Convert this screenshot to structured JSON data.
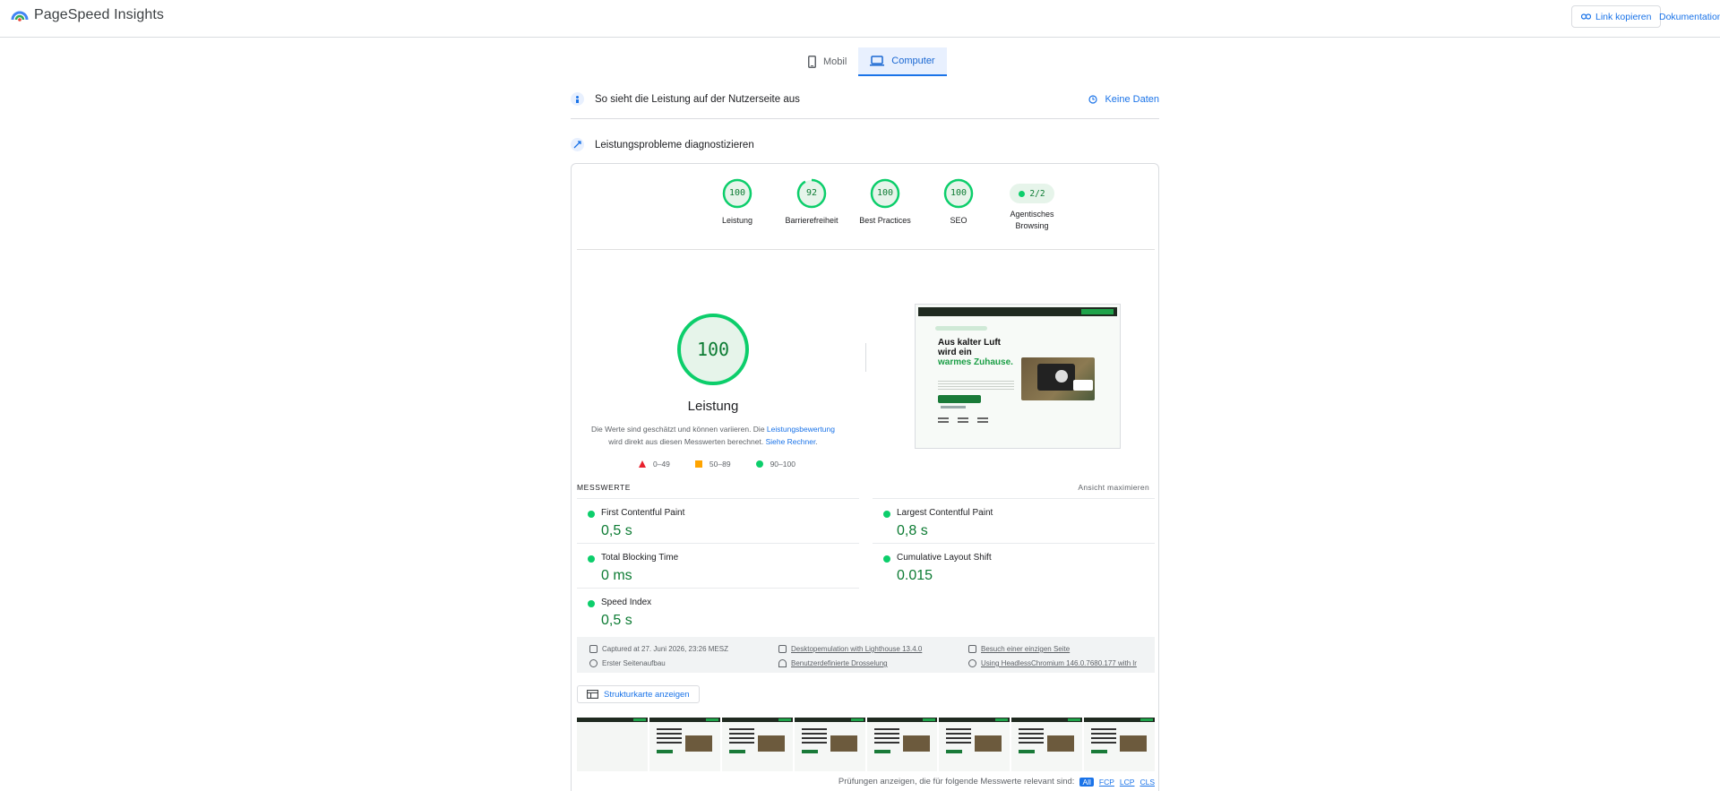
{
  "header": {
    "title": "PageSpeed Insights",
    "copy_link": "Link kopieren",
    "docs": "Dokumentation"
  },
  "tabs": [
    {
      "label": "Mobil",
      "active": false
    },
    {
      "label": "Computer",
      "active": true
    }
  ],
  "field_section": {
    "title": "So sieht die Leistung auf der Nutzerseite aus",
    "no_data": "Keine Daten"
  },
  "lab_section": {
    "title": "Leistungsprobleme diagnostizieren"
  },
  "gauges": [
    {
      "value": "100",
      "label": "Leistung",
      "score": 100
    },
    {
      "value": "92",
      "label": "Barrierefreiheit",
      "score": 92
    },
    {
      "value": "100",
      "label": "Best Practices",
      "score": 100
    },
    {
      "value": "100",
      "label": "SEO",
      "score": 100
    }
  ],
  "agentic": {
    "value": "2/2",
    "label_line1": "Agentisches",
    "label_line2": "Browsing"
  },
  "performance": {
    "score": "100",
    "label": "Leistung",
    "note_part1": "Die Werte sind geschätzt und können variieren. Die ",
    "note_link1": "Leistungsbewertung",
    "note_part2": " wird direkt aus diesen Messwerten berechnet. ",
    "note_link2": "Siehe Rechner",
    "note_end": "."
  },
  "legend": [
    {
      "label": "0–49",
      "color": "#e8212d"
    },
    {
      "label": "50–89",
      "color": "#ffa400"
    },
    {
      "label": "90–100",
      "color": "#0cce6b"
    }
  ],
  "screenshot": {
    "headline_1": "Aus kalter Luft",
    "headline_2": "wird ein",
    "headline_3": "warmes Zuhause."
  },
  "metrics": {
    "heading": "MESSWERTE",
    "expand": "Ansicht maximieren",
    "items": [
      {
        "name": "First Contentful Paint",
        "value": "0,5 s"
      },
      {
        "name": "Largest Contentful Paint",
        "value": "0,8 s"
      },
      {
        "name": "Total Blocking Time",
        "value": "0 ms"
      },
      {
        "name": "Cumulative Layout Shift",
        "value": "0.015"
      },
      {
        "name": "Speed Index",
        "value": "0,5 s"
      }
    ]
  },
  "meta": {
    "captured": "Captured at 27. Juni 2026, 23:26 MESZ",
    "emulation": "Desktopemulation with Lighthouse 13.4.0",
    "single_visit": "Besuch einer einzigen Seite",
    "initial_load": "Erster Seitenaufbau",
    "throttling": "Benutzerdefinierte Drosselung",
    "browser": "Using HeadlessChromium 146.0.7680.177 with lr"
  },
  "treemap": "Strukturkarte anzeigen",
  "relevant": {
    "label": "Prüfungen anzeigen, die für folgende Messwerte relevant sind:",
    "chips": [
      "All",
      "FCP",
      "LCP",
      "CLS"
    ]
  },
  "colors": {
    "accent": "#1a73e8",
    "good": "#0cce6b",
    "good_text": "#0c7b33"
  }
}
